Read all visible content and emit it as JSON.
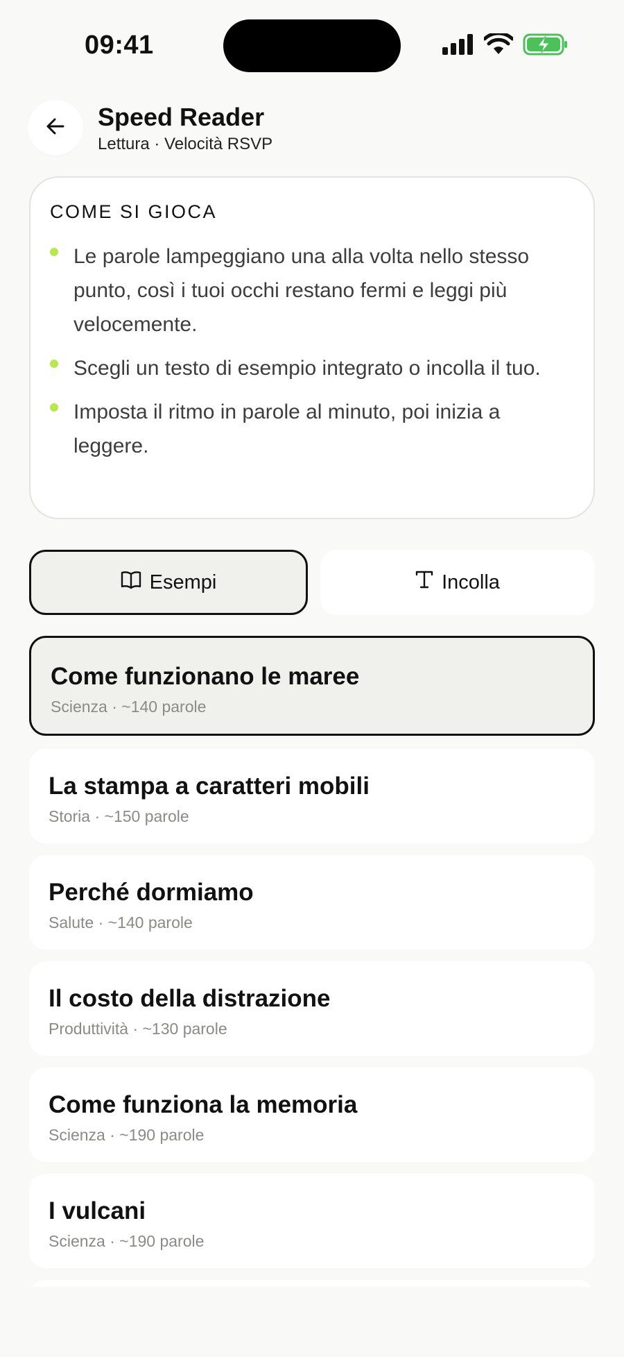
{
  "status_bar": {
    "time": "09:41",
    "icons": [
      "cellular-signal-icon",
      "wifi-icon",
      "battery-charging-icon"
    ],
    "battery_color": "#4cc15a"
  },
  "header": {
    "back_icon": "arrow-left-icon",
    "title": "Speed Reader",
    "subtitle": "Lettura · Velocità RSVP"
  },
  "howto": {
    "title": "COME SI GIOCA",
    "bullet_color": "#b7e84d",
    "items": [
      "Le parole lampeggiano una alla volta nello stesso punto, così i tuoi occhi restano fermi e leggi più velocemente.",
      "Scegli un testo di esempio integrato o incolla il tuo.",
      "Imposta il ritmo in parole al minuto, poi inizia a leggere."
    ]
  },
  "tabs": [
    {
      "label": "Esempi",
      "icon": "book-open-icon",
      "active": true
    },
    {
      "label": "Incolla",
      "icon": "text-type-icon",
      "active": false
    }
  ],
  "samples": [
    {
      "title": "Come funzionano le maree",
      "meta": "Scienza · ~140 parole",
      "selected": true
    },
    {
      "title": "La stampa a caratteri mobili",
      "meta": "Storia · ~150 parole",
      "selected": false
    },
    {
      "title": "Perché dormiamo",
      "meta": "Salute · ~140 parole",
      "selected": false
    },
    {
      "title": "Il costo della distrazione",
      "meta": "Produttività · ~130 parole",
      "selected": false
    },
    {
      "title": "Come funziona la memoria",
      "meta": "Scienza · ~190 parole",
      "selected": false
    },
    {
      "title": "I vulcani",
      "meta": "Scienza · ~190 parole",
      "selected": false
    }
  ]
}
